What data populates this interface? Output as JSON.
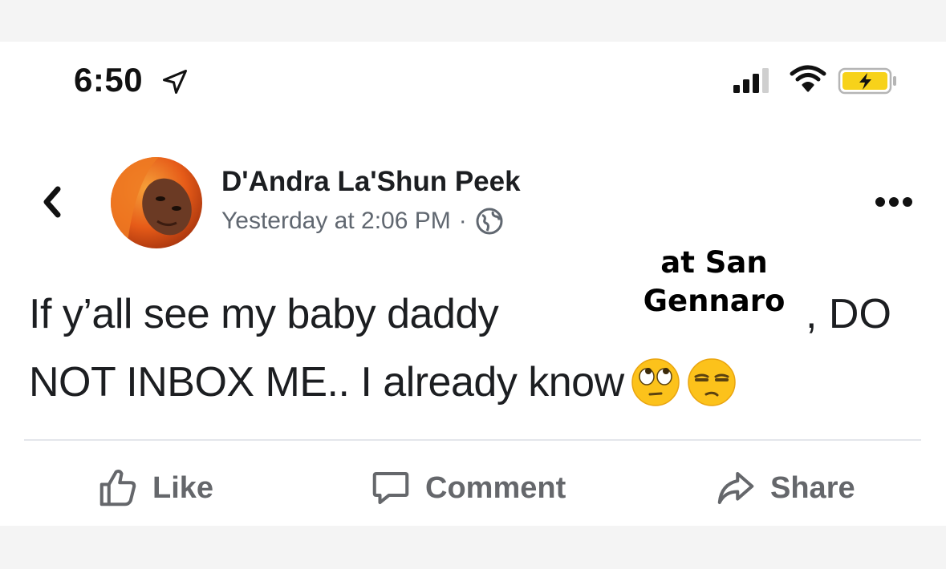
{
  "status_bar": {
    "time": "6:50",
    "icons": [
      "location-arrow-icon",
      "signal-icon",
      "wifi-icon",
      "battery-charging-icon"
    ]
  },
  "post": {
    "author": "D'Andra La'Shun Peek",
    "timestamp": "Yesterday at 2:06 PM",
    "separator": "·",
    "privacy_icon": "globe-icon",
    "text_line1_start": "If y’all see my baby daddy",
    "text_line1_end": ", DO",
    "text_line2": "NOT INBOX ME.. I already know",
    "emojis": [
      "eye-roll-emoji",
      "unamused-emoji"
    ],
    "overlay_line1": "at San",
    "overlay_line2": "Gennaro"
  },
  "actions": {
    "like_label": "Like",
    "comment_label": "Comment",
    "share_label": "Share"
  },
  "colors": {
    "text": "#1c1e21",
    "muted": "#65676b",
    "battery": "#f7d21a"
  }
}
